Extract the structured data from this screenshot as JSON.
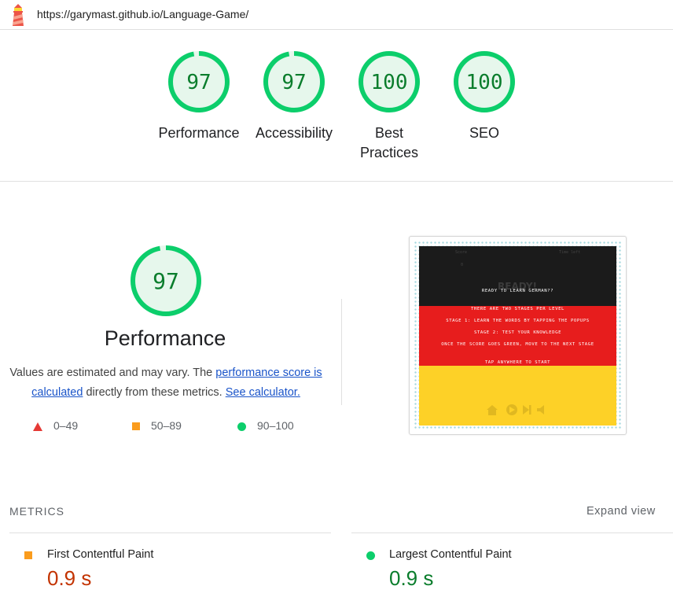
{
  "url": "https://garymast.github.io/Language-Game/",
  "gauges": [
    {
      "score": "97",
      "label_line1": "Performance",
      "label_line2": "",
      "fraction": 0.97
    },
    {
      "score": "97",
      "label_line1": "Accessibility",
      "label_line2": "",
      "fraction": 0.97
    },
    {
      "score": "100",
      "label_line1": "Best",
      "label_line2": "Practices",
      "fraction": 1.0
    },
    {
      "score": "100",
      "label_line1": "SEO",
      "label_line2": "",
      "fraction": 1.0
    }
  ],
  "performance": {
    "score": "97",
    "fraction": 0.97,
    "title": "Performance",
    "desc_prefix": "Values are estimated and may vary. The ",
    "desc_link1": "performance score is calculated",
    "desc_middle": " directly from these metrics. ",
    "desc_link2": "See calculator."
  },
  "legend": {
    "fail": "0–49",
    "average": "50–89",
    "pass": "90–100"
  },
  "thumbnail": {
    "score_label": "Score",
    "score_value": "0",
    "time_label": "Time left",
    "ready_faded": "READY!",
    "line1": "READY TO LEARN GERMAN??",
    "line2": "THERE ARE TWO STAGES PER LEVEL",
    "line3": "STAGE 1: LEARN THE WORDS BY TAPPING THE POPUPS",
    "line4": "STAGE 2: TEST YOUR KNOWLEDGE",
    "line5": "ONCE THE SCORE GOES GREEN, MOVE TO THE NEXT STAGE",
    "line6": "TAP ANYWHERE TO START"
  },
  "metrics": {
    "heading": "METRICS",
    "expand_label": "Expand view",
    "items": [
      {
        "name": "First Contentful Paint",
        "value": "0.9 s",
        "status": "average"
      },
      {
        "name": "Largest Contentful Paint",
        "value": "0.9 s",
        "status": "pass"
      }
    ]
  },
  "colors": {
    "pass": "#0cce6b",
    "pass_fill": "#e6f7ec",
    "pass_text": "#0a7d2c",
    "average": "#fa9c1d",
    "average_text": "#c33300",
    "fail": "#e53935"
  }
}
